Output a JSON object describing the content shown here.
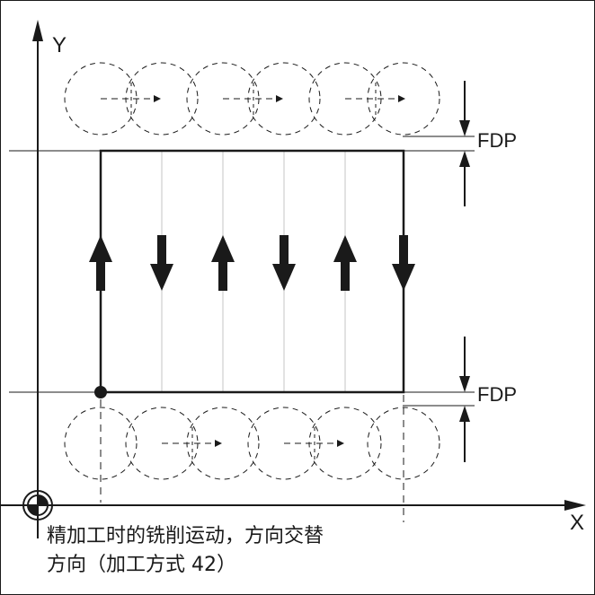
{
  "diagram": {
    "axis_y_label": "Y",
    "axis_x_label": "X",
    "fdp_top_label": "FDP",
    "fdp_bottom_label": "FDP",
    "caption_line1": "精加工时的铣削运动，方向交替",
    "caption_line2": "方向（加工方式 42）",
    "stroke_color": "#1a1a1a",
    "guide_color": "#bdbdbd"
  }
}
